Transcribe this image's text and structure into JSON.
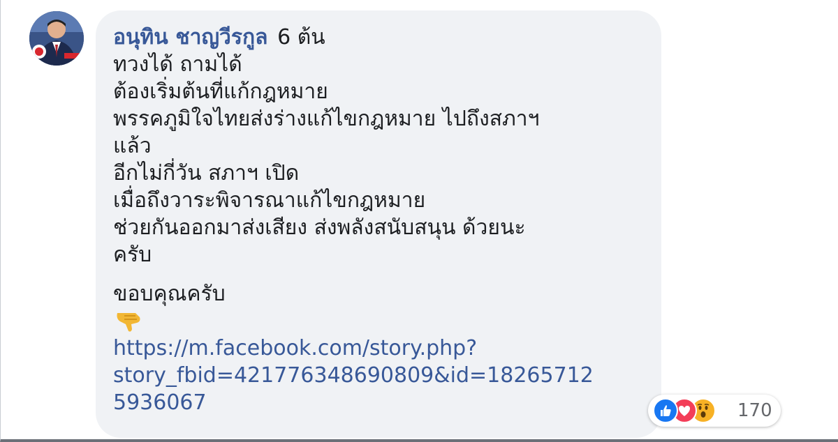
{
  "comment": {
    "author": "อนุทิน ชาญวีรกูล",
    "author_badge": "6 ต้น",
    "lines": [
      "ทวงได้ ถามได้",
      "ต้องเริ่มต้นที่แก้กฎหมาย",
      "พรรคภูมิใจไทยส่งร่างแก้ไขกฎหมาย ไปถึงสภาฯ",
      "แล้ว",
      "อีกไม่กี่วัน สภาฯ เปิด",
      "เมื่อถึงวาระพิจารณาแก้ไขกฎหมาย",
      "ช่วยกันออกมาส่งเสียง ส่งพลังสนับสนุน ด้วยนะ",
      "ครับ"
    ],
    "closing": "ขอบคุณครับ",
    "emoji_icon": "pointing-down-hand-icon",
    "link_lines": [
      "https://m.facebook.com/story.php?",
      "story_fbid=421776348690809&id=18265712",
      "5936067"
    ]
  },
  "reactions": {
    "icons": [
      "like-icon",
      "love-icon",
      "wow-icon"
    ],
    "count": "170"
  },
  "colors": {
    "author": "#385898",
    "link": "#385898",
    "bubble_bg": "#f0f2f5",
    "like": "#1877f2",
    "love": "#f33e58",
    "wow": "#f7b125"
  }
}
